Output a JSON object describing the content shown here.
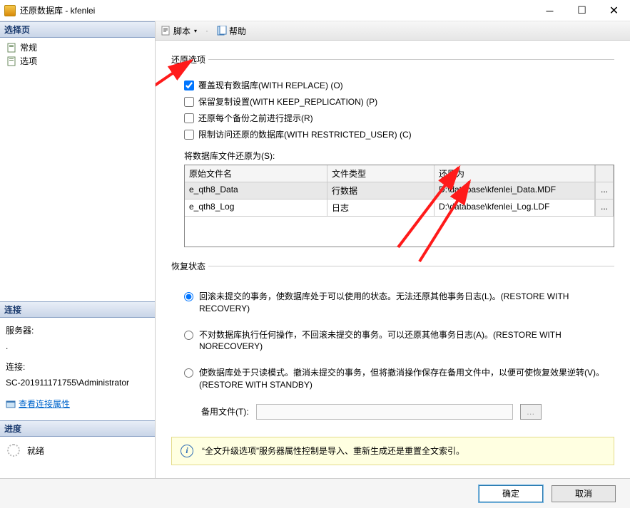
{
  "window": {
    "title": "还原数据库 - kfenlei"
  },
  "left": {
    "select_page_header": "选择页",
    "pages": [
      {
        "label": "常规",
        "icon": "page-icon"
      },
      {
        "label": "选项",
        "icon": "page-icon"
      }
    ],
    "connection_header": "连接",
    "server_label": "服务器:",
    "server_value": ".",
    "conn_label": "连接:",
    "conn_value": "SC-201911171755\\Administrator",
    "view_conn_link": "查看连接属性",
    "progress_header": "进度",
    "progress_value": "就绪"
  },
  "toolbar": {
    "script_label": "脚本",
    "help_label": "帮助"
  },
  "content": {
    "restore_options_legend": "还原选项",
    "checks": [
      {
        "label": "覆盖现有数据库(WITH REPLACE) (O)",
        "checked": true
      },
      {
        "label": "保留复制设置(WITH KEEP_REPLICATION) (P)",
        "checked": false
      },
      {
        "label": "还原每个备份之前进行提示(R)",
        "checked": false
      },
      {
        "label": "限制访问还原的数据库(WITH RESTRICTED_USER) (C)",
        "checked": false
      }
    ],
    "restore_as_label": "将数据库文件还原为(S):",
    "grid_headers": [
      "原始文件名",
      "文件类型",
      "还原为"
    ],
    "grid_rows": [
      {
        "name": "e_qth8_Data",
        "type": "行数据",
        "path": "D:\\database\\kfenlei_Data.MDF"
      },
      {
        "name": "e_qth8_Log",
        "type": "日志",
        "path": "D:\\database\\kfenlei_Log.LDF"
      }
    ],
    "recovery_legend": "恢复状态",
    "radios": [
      "回滚未提交的事务，使数据库处于可以使用的状态。无法还原其他事务日志(L)。(RESTORE WITH RECOVERY)",
      "不对数据库执行任何操作，不回滚未提交的事务。可以还原其他事务日志(A)。(RESTORE WITH NORECOVERY)",
      "使数据库处于只读模式。撤消未提交的事务，但将撤消操作保存在备用文件中，以便可使恢复效果逆转(V)。(RESTORE WITH STANDBY)"
    ],
    "standby_label": "备用文件(T):",
    "info_text": "“全文升级选项”服务器属性控制是导入、重新生成还是重置全文索引。"
  },
  "footer": {
    "ok": "确定",
    "cancel": "取消"
  }
}
